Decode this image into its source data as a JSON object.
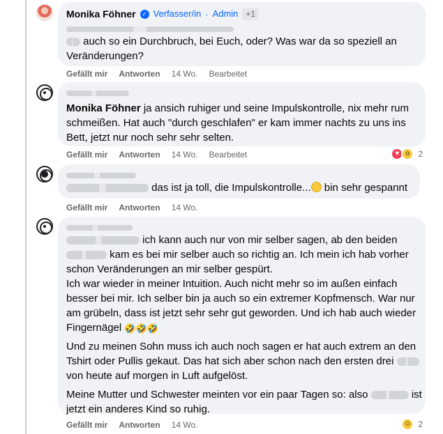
{
  "comments": [
    {
      "author": "Monika Föhner",
      "badge_author": "Verfasser/in",
      "badge_admin": "Admin",
      "badge_more": "+1",
      "lines": [
        "auch so ein Durchbruch, bei Euch, oder? Was war da so speziell an",
        "Veränderungen?"
      ],
      "like": "Gefällt mir",
      "reply": "Antworten",
      "time": "14 Wo.",
      "edited": "Bearbeitet"
    },
    {
      "mention": "Monika Föhner",
      "line1_rest": "ja ansich ruhiger und seine Impulskontrolle, nix mehr rum",
      "lines": [
        "schmeißen. Hat auch \"durch geschlafen\" er kam immer nachts zu uns ins",
        "Bett, jetzt nur noch sehr sehr selten."
      ],
      "like": "Gefällt mir",
      "reply": "Antworten",
      "time": "14 Wo.",
      "edited": "Bearbeitet",
      "reaction_count": "2"
    },
    {
      "text_a": "das ist ja toll, die Impulskontrolle...",
      "text_b": "bin sehr gespannt",
      "like": "Gefällt mir",
      "reply": "Antworten",
      "time": "14 Wo."
    },
    {
      "line1": "ich kann auch nur von mir selber sagen, ab den beiden",
      "line2": "kam es bei mir selber auch so richtig an. Ich mein ich hab vorher",
      "line3": "schon Veränderungen an mir selber gespürt.",
      "line4": "Ich war wieder in meiner Intuition. Auch nicht mehr so im außen einfach",
      "line5": "besser bei mir. Ich selber bin ja auch so ein extremer Kopfmensch. War nur",
      "line6": "am grübeln, dass ist jetzt sehr sehr gut geworden. Und ich hab auch wieder",
      "line7": "Fingernägel",
      "line8": "Und zu meinen Sohn muss ich auch noch sagen er hat auch extrem an den",
      "line9": "Tshirt oder Pullis gekaut. Das hat sich aber schon nach den ersten drei",
      "line10": "von heute auf morgen in Luft aufgelöst.",
      "line11": "Meine Mutter und Schwester meinten vor ein paar Tagen so: also",
      "line11_end": "ist",
      "line12": "jetzt ein anderes Kind so ruhig.",
      "like": "Gefällt mir",
      "reply": "Antworten",
      "time": "14 Wo.",
      "reaction_count": "2"
    }
  ]
}
